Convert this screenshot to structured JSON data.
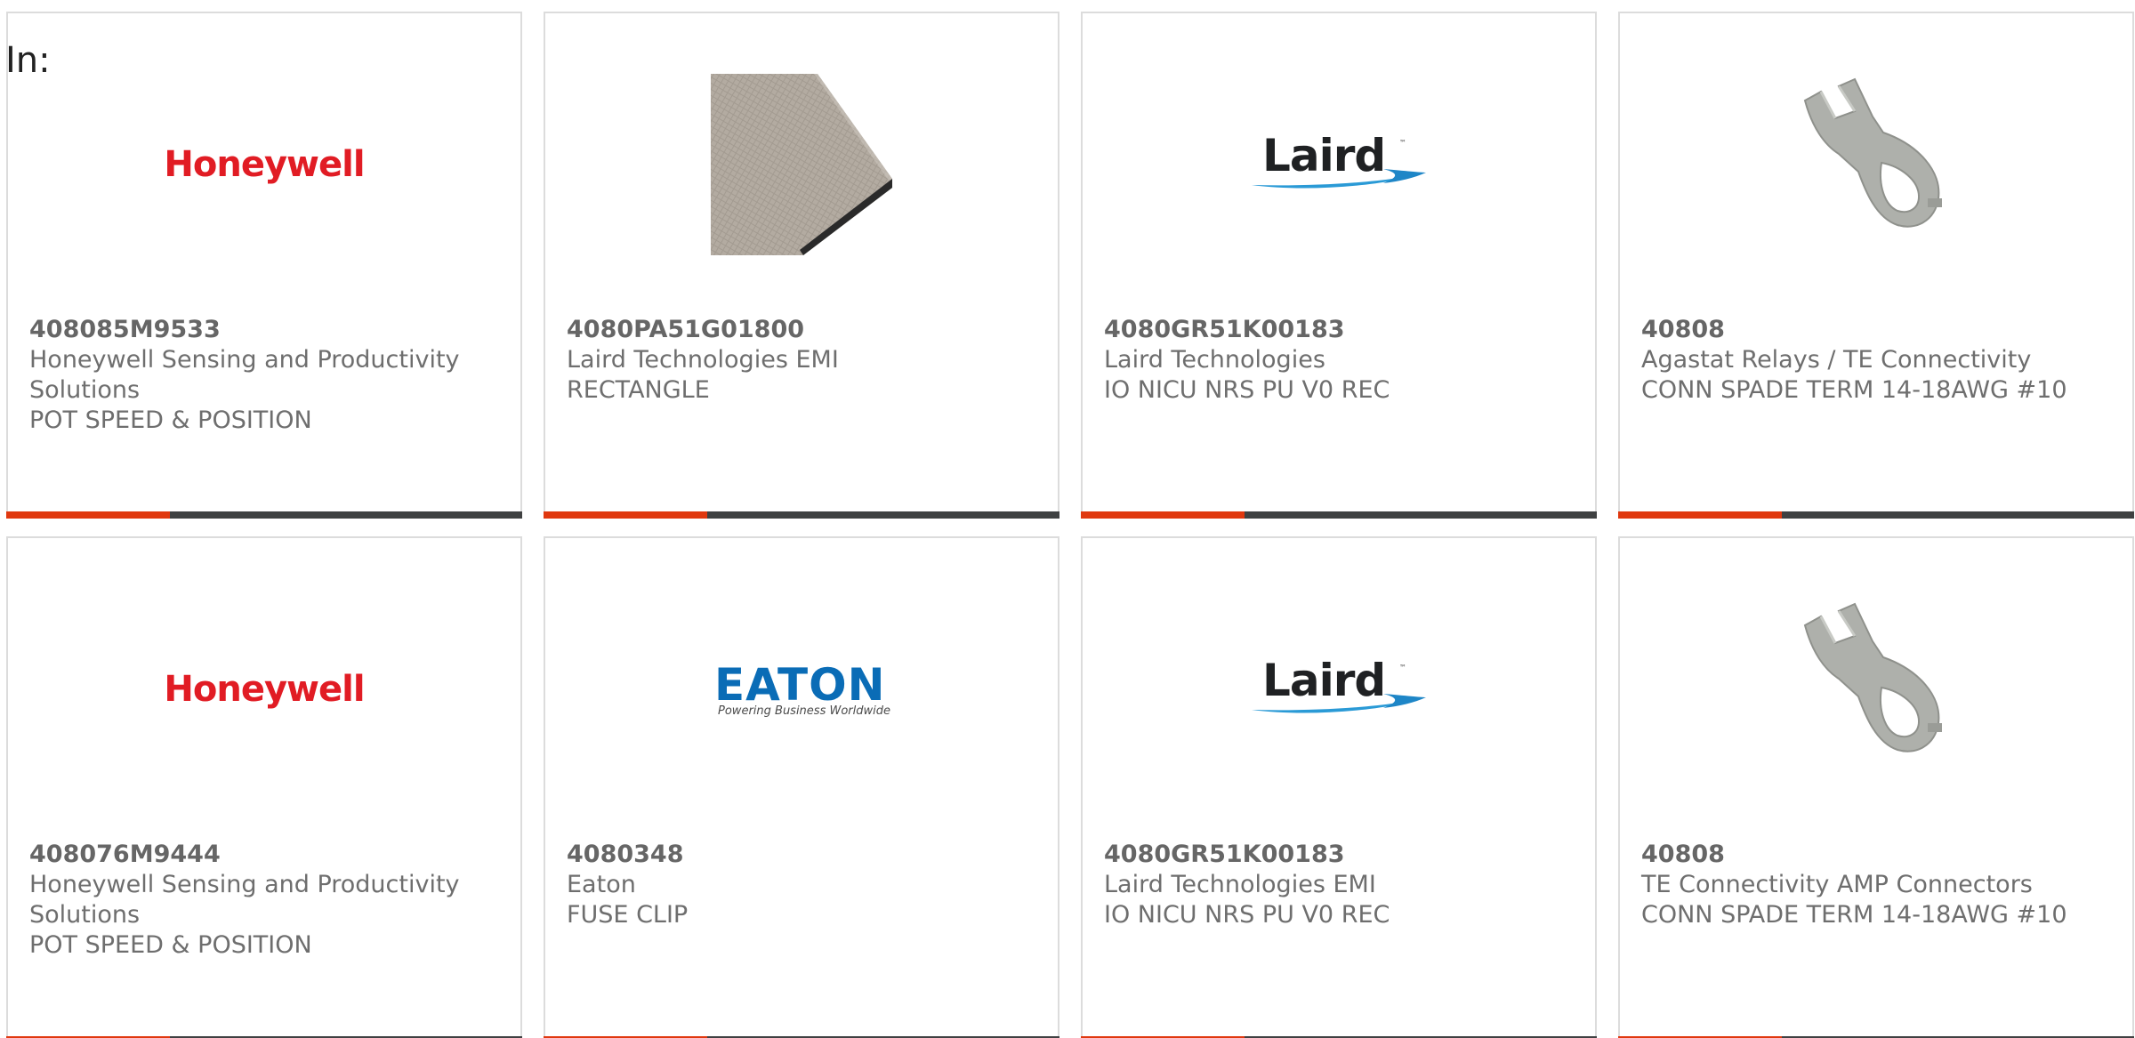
{
  "filter": {
    "label": "In:"
  },
  "products": [
    {
      "part_number": "408085M9533",
      "manufacturer": "Honeywell Sensing and Productivity Solutions",
      "description": "POT SPEED & POSITION",
      "image": {
        "kind": "honeywell-logo",
        "text": "Honeywell",
        "color": "#e11c24"
      }
    },
    {
      "part_number": "4080PA51G01800",
      "manufacturer": "Laird Technologies EMI",
      "description": "RECTANGLE",
      "image": {
        "kind": "gasket-photo"
      }
    },
    {
      "part_number": "4080GR51K00183",
      "manufacturer": "Laird Technologies",
      "description": "IO NICU NRS PU V0 REC",
      "image": {
        "kind": "laird-logo",
        "text": "Laird",
        "tm": "™",
        "color": "#1f2123"
      }
    },
    {
      "part_number": "40808",
      "manufacturer": "Agastat Relays / TE Connectivity",
      "description": "CONN SPADE TERM 14-18AWG #10",
      "image": {
        "kind": "spade-terminal-photo"
      }
    },
    {
      "part_number": "408076M9444",
      "manufacturer": "Honeywell Sensing and Productivity Solutions",
      "description": "POT SPEED & POSITION",
      "image": {
        "kind": "honeywell-logo",
        "text": "Honeywell",
        "color": "#e11c24"
      }
    },
    {
      "part_number": "4080348",
      "manufacturer": "Eaton",
      "description": "FUSE CLIP",
      "image": {
        "kind": "eaton-logo",
        "text": "EATON",
        "tagline": "Powering Business Worldwide",
        "color": "#0a6cb6"
      }
    },
    {
      "part_number": "4080GR51K00183",
      "manufacturer": "Laird Technologies EMI",
      "description": "IO NICU NRS PU V0 REC",
      "image": {
        "kind": "laird-logo",
        "text": "Laird",
        "tm": "™",
        "color": "#1f2123"
      }
    },
    {
      "part_number": "40808",
      "manufacturer": "TE Connectivity AMP Connectors",
      "description": "CONN SPADE TERM 14-18AWG #10",
      "image": {
        "kind": "spade-terminal-photo"
      }
    }
  ],
  "colors": {
    "accent": "#e0380f",
    "bar": "#3f4142",
    "card_border": "#dcdcdc",
    "text": "#6e6e6e"
  }
}
